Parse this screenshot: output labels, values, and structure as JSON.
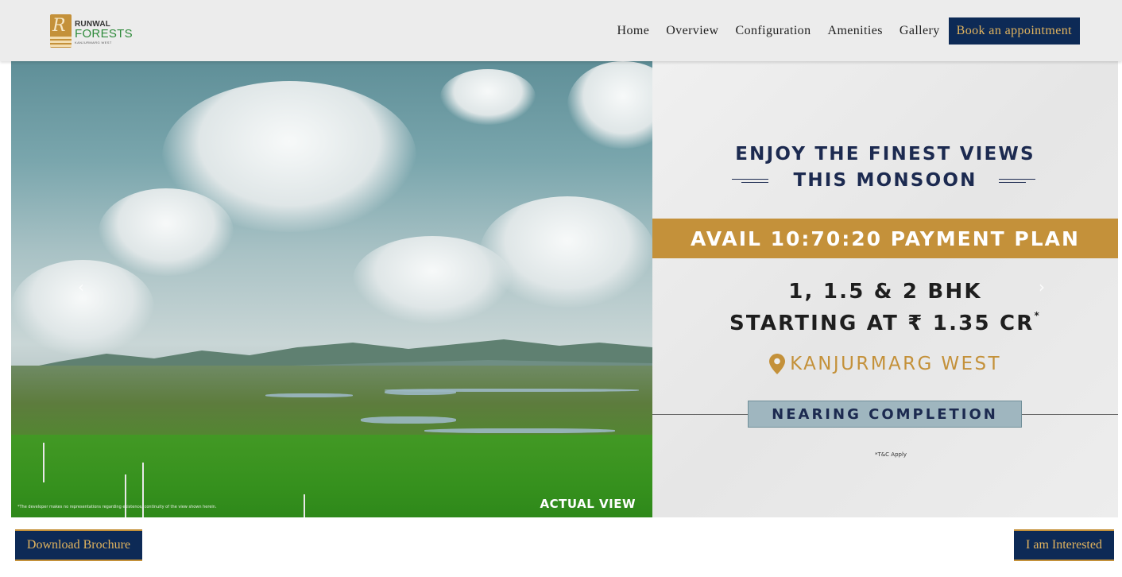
{
  "brand": {
    "logo_top": "RUNWAL",
    "logo_main": "FORESTS",
    "logo_sub": "KANJURMARG WEST",
    "colors": {
      "navy": "#0d2a56",
      "gold": "#c4913a",
      "green": "#2e8a3a"
    }
  },
  "nav": {
    "items": [
      {
        "label": "Home"
      },
      {
        "label": "Overview"
      },
      {
        "label": "Configuration"
      },
      {
        "label": "Amenities"
      },
      {
        "label": "Gallery"
      }
    ],
    "cta": "Book an appointment"
  },
  "hero": {
    "image_label": "ACTUAL VIEW",
    "disclaimer": "*The developer makes no representations regarding existence/ continuity of the view shown herein.",
    "prev_icon": "chevron-left-icon",
    "next_icon": "chevron-right-icon",
    "prev_glyph": "‹",
    "next_glyph": "›",
    "headline_1": "ENJOY THE FINEST VIEWS",
    "headline_2": "THIS MONSOON",
    "plan": "AVAIL 10:70:20 PAYMENT PLAN",
    "bhk_line_1": "1, 1.5 & 2 BHK",
    "bhk_line_2": "STARTING AT ₹ 1.35 CR",
    "bhk_asterisk": "*",
    "location": "KANJURMARG WEST",
    "location_icon": "map-pin-icon",
    "status": "NEARING COMPLETION",
    "tc": "*T&C Apply"
  },
  "actions": {
    "brochure": "Download Brochure",
    "interested": "I am Interested"
  }
}
